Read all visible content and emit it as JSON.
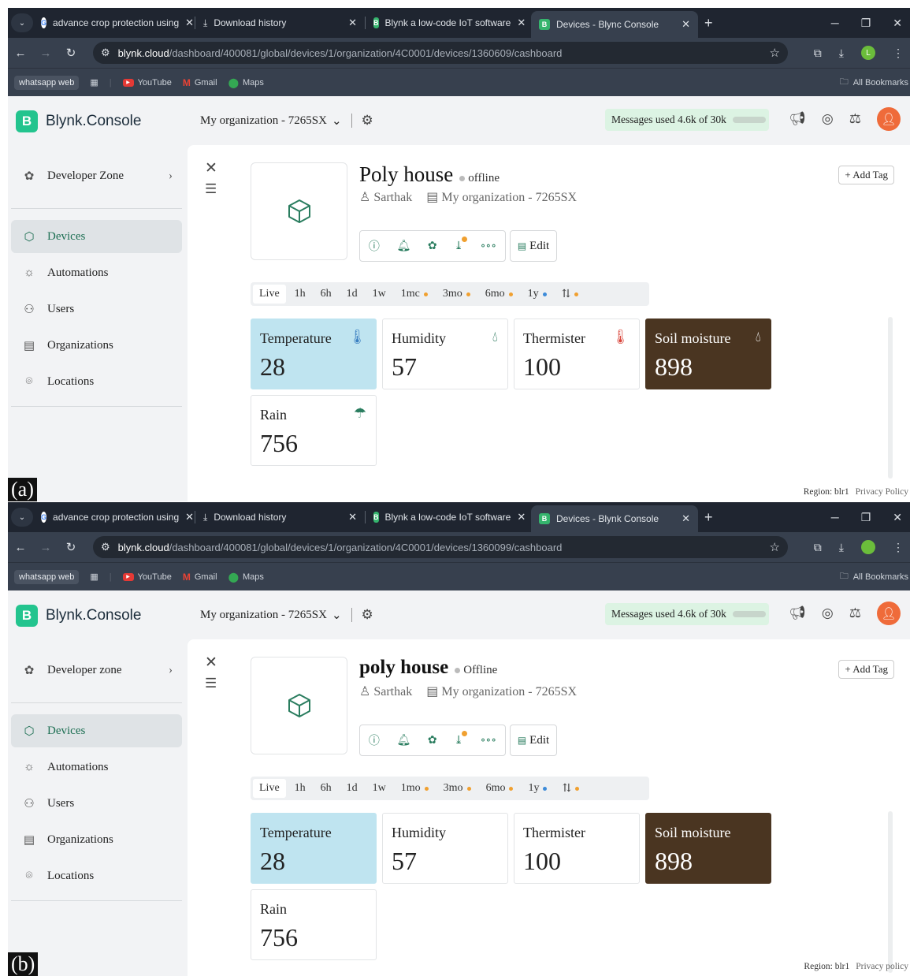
{
  "panels": [
    {
      "tag": "(a)",
      "tabs": [
        {
          "label": "advance crop protection using",
          "icon": "google-icon"
        },
        {
          "label": "Download history",
          "icon": "download-icon"
        },
        {
          "label": "Blynk a low-code IoT software",
          "icon": "blynk-icon"
        },
        {
          "label": "Devices - Blync Console",
          "icon": "blynk-icon"
        }
      ],
      "url_host": "blynk.cloud",
      "url_path": "/dashboard/400081/global/devices/1/organization/4C0001/devices/1360609/cashboard",
      "profile_initial": "L",
      "bookmarks": {
        "whatsapp": "whatsapp web",
        "youtube": "YouTube",
        "gmail": "Gmail",
        "maps": "Maps",
        "all": "All Bookmarks"
      },
      "brand": "Blynk.Console",
      "brand_logo": "B",
      "sidebar": {
        "developer_zone": "Developer Zone",
        "devices": "Devices",
        "automations": "Automations",
        "users": "Users",
        "organizations": "Organizations",
        "locations": "Locations"
      },
      "org_select": "My organization - 7265SX",
      "messages_used": "Messages used 4.6k of 30k",
      "messages_fraction": 0.15,
      "device": {
        "name": "Poly house",
        "status": "offline",
        "owner": "Sarthak",
        "org": "My organization - 7265SX",
        "add_tag": "Add Tag",
        "edit": "Edit"
      },
      "time_ranges": [
        "Live",
        "1h",
        "6h",
        "1d",
        "1w",
        "1mc",
        "3mo",
        "6mo",
        "1y"
      ],
      "tiles": {
        "temperature": {
          "label": "Temperature",
          "value": "28"
        },
        "humidity": {
          "label": "Humidity",
          "value": "57"
        },
        "thermister": {
          "label": "Thermister",
          "value": "100"
        },
        "soil": {
          "label": "Soil moisture",
          "value": "898"
        },
        "rain": {
          "label": "Rain",
          "value": "756"
        }
      },
      "footer": {
        "region": "Region: blr1",
        "privacy": "Privacy Policy"
      }
    },
    {
      "tag": "(b)",
      "tabs": [
        {
          "label": "advance crop protection using",
          "icon": "google-icon"
        },
        {
          "label": "Download history",
          "icon": "download-icon"
        },
        {
          "label": "Blynk a low-code IoT software",
          "icon": "blynk-icon"
        },
        {
          "label": "Devices - Blynk Console",
          "icon": "blynk-icon"
        }
      ],
      "url_host": "blynk.cloud",
      "url_path": "/dashboard/400081/global/devices/1/organization/4C0001/devices/1360099/cashboard",
      "profile_initial": "",
      "bookmarks": {
        "whatsapp": "whatsapp web",
        "youtube": "YouTube",
        "gmail": "Gmail",
        "maps": "Maps",
        "all": "All Bookmarks"
      },
      "brand": "Blynk.Console",
      "brand_logo": "B",
      "sidebar": {
        "developer_zone": "Developer zone",
        "devices": "Devices",
        "automations": "Automations",
        "users": "Users",
        "organizations": "Organizations",
        "locations": "Locations"
      },
      "org_select": "My organization - 7265SX",
      "messages_used": "Messages used 4.6k of 30k",
      "messages_fraction": 0.15,
      "device": {
        "name": "poly house",
        "status": "Offline",
        "owner": "Sarthak",
        "org": "My organization - 7265SX",
        "add_tag": "Add Tag",
        "edit": "Edit"
      },
      "time_ranges": [
        "Live",
        "1h",
        "6h",
        "1d",
        "1w",
        "1mo",
        "3mo",
        "6mo",
        "1y"
      ],
      "tiles": {
        "temperature": {
          "label": "Temperature",
          "value": "28"
        },
        "humidity": {
          "label": "Humidity",
          "value": "57"
        },
        "thermister": {
          "label": "Thermister",
          "value": "100"
        },
        "soil": {
          "label": "Soil moisture",
          "value": "898"
        },
        "rain": {
          "label": "Rain",
          "value": "756"
        }
      },
      "footer": {
        "region": "Region: blr1",
        "privacy": "Privacy policy"
      }
    }
  ],
  "colors": {
    "accent": "#23c48e",
    "temp_tile": "#bfe4f0",
    "soil_tile": "#4a3521",
    "browser_dark": "#1f2530"
  }
}
